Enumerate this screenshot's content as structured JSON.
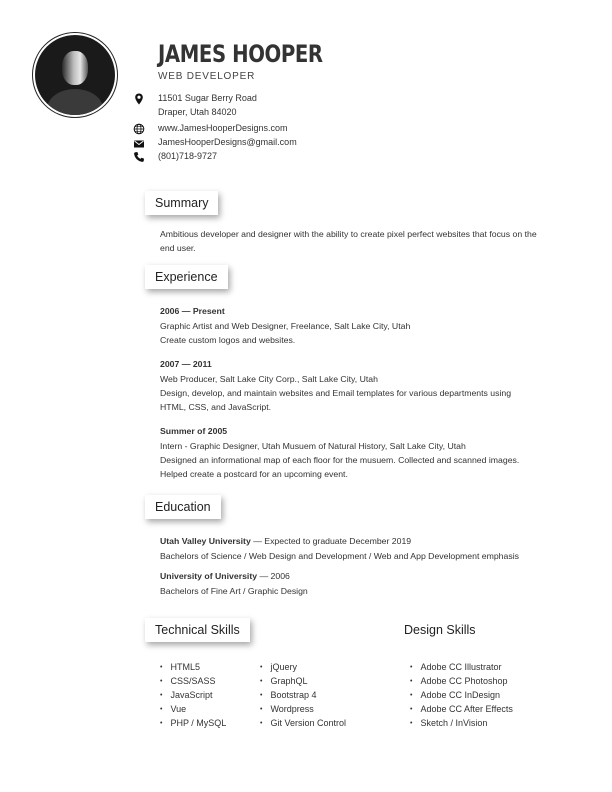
{
  "header": {
    "name": "JAMES HOOPER",
    "title": "WEB DEVELOPER",
    "address_line1": "11501 Sugar Berry Road",
    "address_line2": "Draper, Utah 84020",
    "website": "www.JamesHooperDesigns.com",
    "email": "JamesHooperDesigns@gmail.com",
    "phone": "(801)718-9727"
  },
  "summary": {
    "heading": "Summary",
    "line1": "Ambitious developer and designer with the ability to create pixel perfect websites that focus on the",
    "line2": "end user."
  },
  "experience": {
    "heading": "Experience",
    "jobs": [
      {
        "dates": "2006 — Present",
        "lines": [
          "Graphic Artist and Web Designer, Freelance, Salt Lake City, Utah",
          "Create custom logos and websites."
        ]
      },
      {
        "dates": "2007 — 2011",
        "lines": [
          "Web Producer, Salt Lake City Corp., Salt Lake City, Utah",
          "Design, develop, and maintain websites and Email templates for various departments using",
          "HTML, CSS, and JavaScript."
        ]
      },
      {
        "dates": "Summer of 2005",
        "lines": [
          "Intern - Graphic Designer, Utah Musuem of Natural History, Salt Lake City, Utah",
          "Designed an informational map of each floor for the musuem. Collected and scanned images.",
          "Helped create a postcard for an upcoming event."
        ]
      }
    ]
  },
  "education": {
    "heading": "Education",
    "schools": [
      {
        "name": "Utah Valley University",
        "note": " — Expected to graduate December 2019",
        "degree": "Bachelors of Science / Web Design and Development / Web and App Development emphasis"
      },
      {
        "name": "University of University",
        "note": " — 2006",
        "degree": "Bachelors of Fine Art / Graphic Design"
      }
    ]
  },
  "technical_skills": {
    "heading": "Technical Skills",
    "col1": [
      "HTML5",
      "CSS/SASS",
      "JavaScript",
      "Vue",
      "PHP / MySQL"
    ],
    "col2": [
      "jQuery",
      "GraphQL",
      "Bootstrap 4",
      "Wordpress",
      "Git Version Control"
    ]
  },
  "design_skills": {
    "heading": "Design Skills",
    "items": [
      "Adobe CC Illustrator",
      "Adobe CC Photoshop",
      "Adobe CC InDesign",
      "Adobe CC After Effects",
      "Sketch / InVision"
    ]
  },
  "icons": {
    "address": "map-pin-icon",
    "website": "globe-icon",
    "email": "envelope-icon",
    "phone": "phone-icon"
  }
}
